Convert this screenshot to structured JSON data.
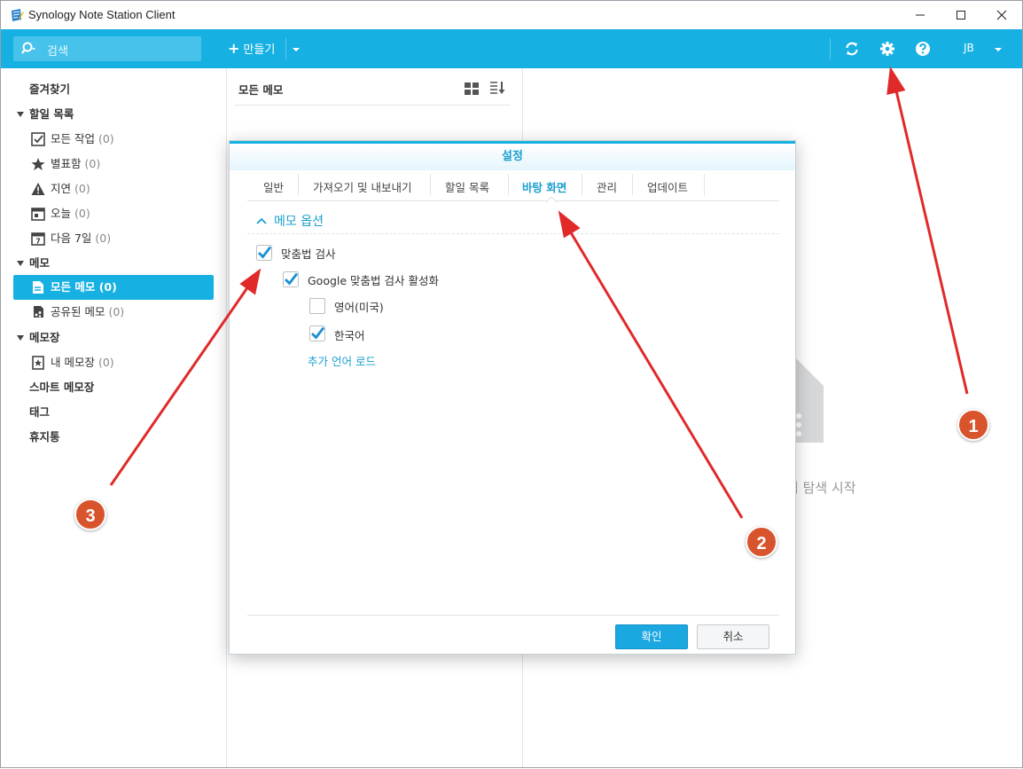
{
  "window": {
    "title": "Synology Note Station Client"
  },
  "toolbar": {
    "search_placeholder": "검색",
    "create_label": "만들기",
    "user": "JB",
    "icons": [
      "sync-icon",
      "gear-icon",
      "help-icon"
    ]
  },
  "sidebar": {
    "favorites": "즐겨찾기",
    "todo": {
      "label": "할일 목록",
      "items": [
        {
          "label": "모든 작업",
          "count": "(0)",
          "icon": "checkbox-icon"
        },
        {
          "label": "별표함",
          "count": "(0)",
          "icon": "star-icon"
        },
        {
          "label": "지연",
          "count": "(0)",
          "icon": "warning-icon"
        },
        {
          "label": "오늘",
          "count": "(0)",
          "icon": "calendar-icon"
        },
        {
          "label": "다음 7일",
          "count": "(0)",
          "icon": "calendar-7-icon"
        }
      ]
    },
    "notes": {
      "label": "메모",
      "items": [
        {
          "label": "모든 메모",
          "count": "(0)",
          "icon": "note-icon"
        },
        {
          "label": "공유된 메모",
          "count": "(0)",
          "icon": "shared-note-icon"
        }
      ]
    },
    "notebooks": {
      "label": "메모장",
      "items": [
        {
          "label": "내 메모장",
          "count": "(0)",
          "icon": "notebook-icon"
        }
      ]
    },
    "smart": "스마트 메모장",
    "tags": "태그",
    "trash": "휴지통"
  },
  "middle": {
    "title": "모든 메모"
  },
  "right": {
    "empty_text": "여 탐색 시작"
  },
  "dialog": {
    "title": "설정",
    "tabs": [
      "일반",
      "가져오기 및 내보내기",
      "할일 목록",
      "바탕 화면",
      "관리",
      "업데이트"
    ],
    "active_tab": "바탕 화면",
    "section": "메모 옵션",
    "options": {
      "spellcheck": "맞춤법 검사",
      "google": "Google 맞춤법 검사 활성화",
      "english": "영어(미국)",
      "korean": "한국어",
      "load_more": "추가 언어 로드"
    },
    "ok": "확인",
    "cancel": "취소"
  },
  "annotations": [
    "1",
    "2",
    "3"
  ],
  "colors": {
    "accent": "#17b0e2",
    "annotation": "#d8542c",
    "arrow": "#e02a2a"
  }
}
